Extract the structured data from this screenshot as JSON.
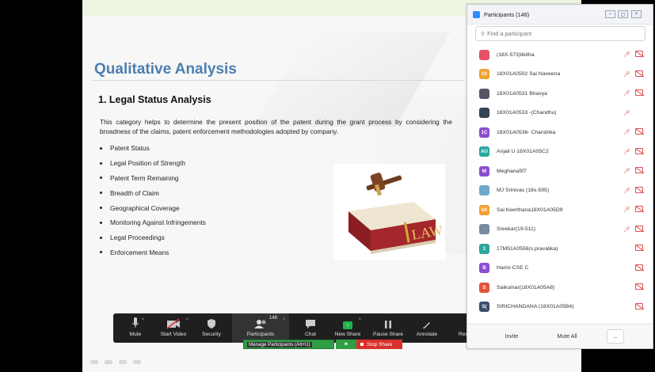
{
  "slide": {
    "title": "Qualitative Analysis",
    "section_heading": "1. Legal Status Analysis",
    "description": "This category helps to determine the present position of the patent during the grant process by considering the broadness of the claims, patent enforcement methodologies adopted by company.",
    "bullets": [
      "Patent Status",
      "Legal Position of Strength",
      "Patent Term Remaining",
      "Breadth of Claim",
      "Geographical Coverage",
      "Monitoring Against Infringements",
      "Legal Proceedings",
      "Enforcement Means"
    ],
    "image_text": "LAW",
    "title_color": "#4a7fb0"
  },
  "toolbar": {
    "mute_label": "Mute",
    "start_video_label": "Start Video",
    "security_label": "Security",
    "participants_label": "Participants",
    "participants_count": "148",
    "chat_label": "Chat",
    "new_share_label": "New Share",
    "pause_share_label": "Pause Share",
    "annotate_label": "Annotate",
    "more_label": "Rem",
    "tooltip": "Manage Participants (Alt+U)",
    "stop_share_label": "Stop Share",
    "accent_green": "#22b14c",
    "stop_red": "#d9302b"
  },
  "panel": {
    "title": "Participants (148)",
    "search_placeholder": "Find a participant",
    "participants": [
      {
        "initials": "",
        "name": "(18X-573)likitha",
        "color": "#e8506a",
        "mic_muted": true,
        "video_off": true
      },
      {
        "initials": "1S",
        "name": "18X01A0502 Sai Naveena",
        "color": "#f0a030",
        "mic_muted": true,
        "video_off": true
      },
      {
        "initials": "",
        "name": "18X01A0531 Bhavya",
        "color": "#555566",
        "mic_muted": true,
        "video_off": true
      },
      {
        "initials": "",
        "name": "18X01A0533 -(Chandhu)",
        "color": "#334455",
        "mic_muted": true,
        "video_off": false
      },
      {
        "initials": "1C",
        "name": "18X01A0536- Chandrika",
        "color": "#8a4fd0",
        "mic_muted": true,
        "video_off": true
      },
      {
        "initials": "AU",
        "name": "Anjali U 18X01A05C2",
        "color": "#2aa79b",
        "mic_muted": true,
        "video_off": true
      },
      {
        "initials": "M",
        "name": "Meghana5f7",
        "color": "#8a4fd0",
        "mic_muted": true,
        "video_off": true
      },
      {
        "initials": "",
        "name": "MJ Srinivas (18x-595)",
        "color": "#6fa8c8",
        "mic_muted": true,
        "video_off": true
      },
      {
        "initials": "SK",
        "name": "Sai Keerthana18X01A05D9",
        "color": "#f0a030",
        "mic_muted": true,
        "video_off": true
      },
      {
        "initials": "",
        "name": "Sreekar(19-511)",
        "color": "#7a8aa0",
        "mic_muted": true,
        "video_off": true
      },
      {
        "initials": "1",
        "name": "17M51A0556(s.pravalika)",
        "color": "#2aa79b",
        "mic_muted": false,
        "video_off": true
      },
      {
        "initials": "B",
        "name": "Harini CSE C",
        "color": "#8a4fd0",
        "mic_muted": false,
        "video_off": true
      },
      {
        "initials": "S",
        "name": "Saikumar(18X01A05A8)",
        "color": "#e0553c",
        "mic_muted": false,
        "video_off": true
      },
      {
        "initials": "S(",
        "name": "SIRICHANDANA (18X01A05B4)",
        "color": "#3a4a6a",
        "mic_muted": false,
        "video_off": true
      }
    ],
    "invite_label": "Invite",
    "mute_all_label": "Mute All",
    "more_label": "..."
  }
}
